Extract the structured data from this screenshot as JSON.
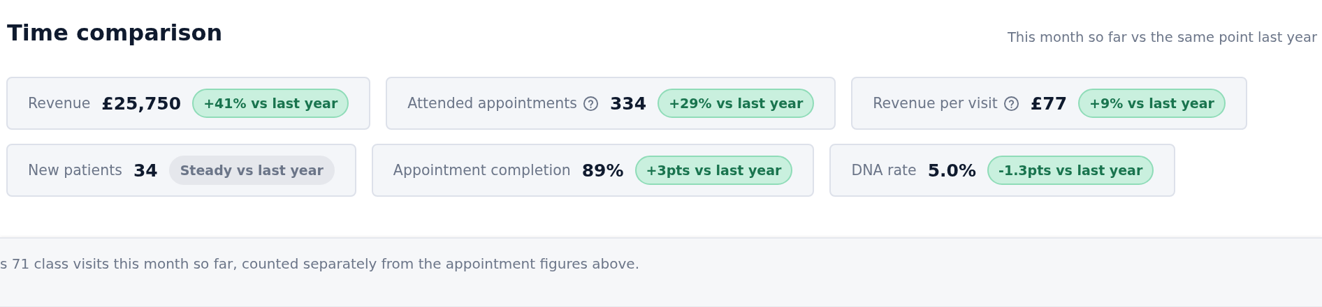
{
  "title": "Time comparison",
  "subtitle": "This month so far vs the same point last year",
  "rows": [
    {
      "metrics": [
        {
          "label": "Revenue",
          "help": false,
          "value": "£25,750",
          "badge": {
            "text": "+41% vs last year",
            "kind": "positive"
          }
        },
        {
          "label": "Attended appointments",
          "help": true,
          "value": "334",
          "badge": {
            "text": "+29% vs last year",
            "kind": "positive"
          }
        },
        {
          "label": "Revenue per visit",
          "help": true,
          "value": "£77",
          "badge": {
            "text": "+9% vs last year",
            "kind": "positive"
          }
        }
      ]
    },
    {
      "metrics": [
        {
          "label": "New patients",
          "help": false,
          "value": "34",
          "badge": {
            "text": "Steady vs last year",
            "kind": "neutral"
          }
        },
        {
          "label": "Appointment completion",
          "help": false,
          "value": "89%",
          "badge": {
            "text": "+3pts vs last year",
            "kind": "positive"
          }
        },
        {
          "label": "DNA rate",
          "help": false,
          "value": "5.0%",
          "badge": {
            "text": "-1.3pts vs last year",
            "kind": "positive"
          }
        }
      ]
    }
  ],
  "note": "s 71 class visits this month so far, counted separately from the appointment figures above."
}
